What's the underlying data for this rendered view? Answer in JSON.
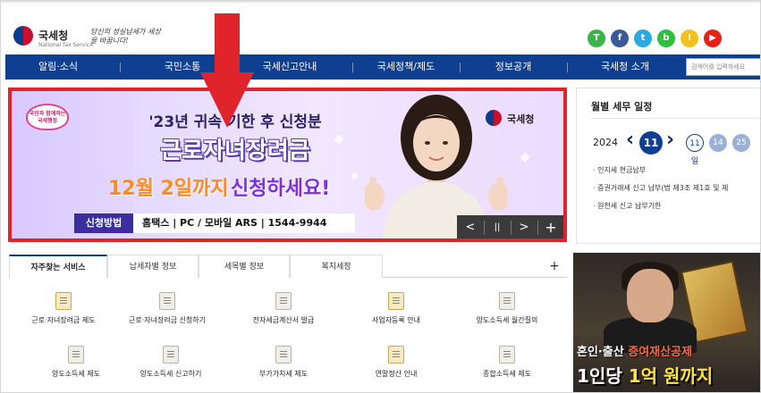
{
  "header": {
    "logo_text": "국세청",
    "logo_sub": "National Tax Service",
    "slogan": "당신의 성실납세가 세상을 바꿉니다!",
    "social_icons": [
      {
        "name": "talk-icon",
        "glyph": "T",
        "color": "#3bb54a"
      },
      {
        "name": "facebook-icon",
        "glyph": "f",
        "color": "#3b5998"
      },
      {
        "name": "twitter-icon",
        "glyph": "t",
        "color": "#29a9e1"
      },
      {
        "name": "blog-icon",
        "glyph": "b",
        "color": "#2fbf3f"
      },
      {
        "name": "bulb-icon",
        "glyph": "!",
        "color": "#f3c11b"
      },
      {
        "name": "youtube-icon",
        "glyph": "▶",
        "color": "#e62117"
      }
    ]
  },
  "nav": {
    "items": [
      "알림·소식",
      "국민소통",
      "국세신고안내",
      "국세정책/제도",
      "정보공개",
      "국세청 소개"
    ],
    "search_placeholder": "검색어를 입력하세요"
  },
  "banner": {
    "badge": "국민과 함께하는 국세행정",
    "line1": "'23년 귀속 기한 후 신청분",
    "line2": "근로자녀장려금",
    "line3_a": "12월 2일까지",
    "line3_b": "신청하세요!",
    "method_label": "신청방법",
    "method_text": "홈택스 | PC / 모바일  ARS | 1544-9944",
    "agency": "국세청",
    "controls": {
      "prev": "<",
      "pause": "||",
      "next": ">",
      "more": "+"
    }
  },
  "tax_panel": {
    "title": "월별 세무 일정",
    "year": "2024",
    "prev": "‹",
    "month": "11",
    "next": "›",
    "days": [
      "11일",
      "14",
      "25"
    ],
    "items": [
      "· 인지세 현금납부",
      "· 증권거래세 신고 납부(법 제3조 제1호 및 제",
      "· 원천세 신고 납부기한"
    ]
  },
  "tabs": {
    "items": [
      "자주찾는 서비스",
      "납세자별 정보",
      "세목별 정보",
      "복지세정"
    ],
    "plus": "+"
  },
  "services": [
    "근로·자녀장려금 제도",
    "근로·자녀장려금 신청하기",
    "전자세금계산서 발급",
    "사업자등록 안내",
    "양도소득세 월간질의",
    "양도소득세 제도",
    "양도소득세 신고하기",
    "부가가치세 제도",
    "연말정산 안내",
    "종합소득세 제도"
  ],
  "video": {
    "line1_a": "혼인·출산 ",
    "line1_b": "증여재산공제",
    "line2_a": "1인당 ",
    "line2_b": "1억 원까지"
  },
  "colors": {
    "nav_bg": "#0f3f91",
    "highlight_border": "#e0242b",
    "arrow": "#e0242b"
  }
}
